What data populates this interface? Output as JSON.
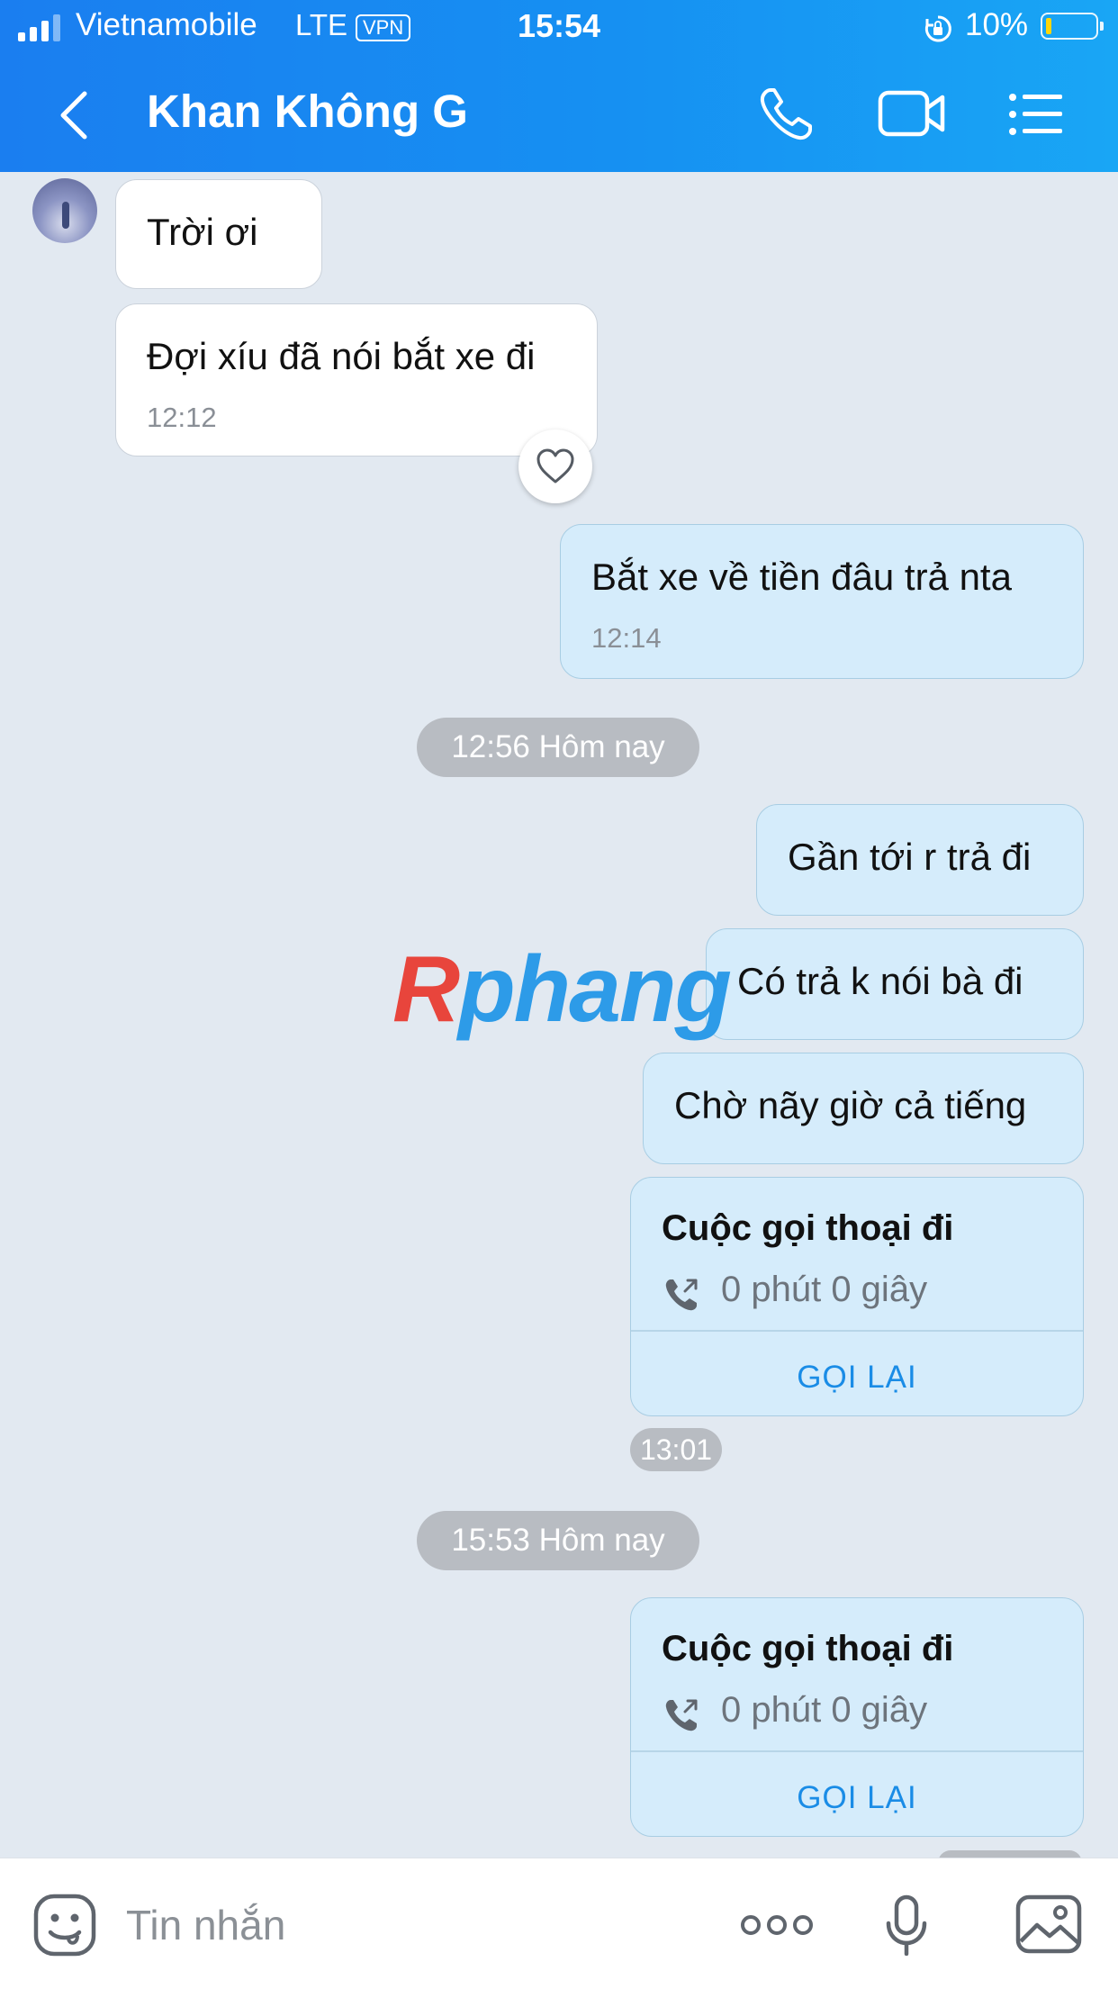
{
  "status_bar": {
    "carrier": "Vietnamobile",
    "network": "LTE",
    "vpn": "VPN",
    "time": "15:54",
    "battery": "10%"
  },
  "header": {
    "title": "Khan Không G",
    "icons": [
      "back-icon",
      "phone-icon",
      "video-call-icon",
      "menu-icon"
    ]
  },
  "messages": {
    "in1": {
      "text": "Trời ơi"
    },
    "in2": {
      "text": "Đợi xíu đã nói bắt xe đi",
      "time": "12:12"
    },
    "out1": {
      "text": "Bắt xe về tiền đâu trả nta",
      "time": "12:14"
    },
    "sep1": "12:56 Hôm nay",
    "out2": {
      "text": "Gần tới r trả đi"
    },
    "out3": {
      "text": "Có trả k nói bà đi"
    },
    "out4": {
      "text": "Chờ nãy giờ cả tiếng"
    },
    "call1": {
      "title": "Cuộc gọi thoại đi",
      "duration": "0 phút 0 giây",
      "recall": "GỌI LẠI",
      "time": "13:01"
    },
    "sep2": "15:53 Hôm nay",
    "call2": {
      "title": "Cuộc gọi thoại đi",
      "duration": "0 phút 0 giây",
      "recall": "GỌI LẠI"
    }
  },
  "watermark": {
    "first": "R",
    "rest": "phang"
  },
  "input": {
    "placeholder": "Tin nhắn"
  },
  "colors": {
    "header_start": "#1a7ef0",
    "header_end": "#19a6f5",
    "outgoing_bubble": "#d5ecfb",
    "incoming_bubble": "#ffffff",
    "recall_link": "#1a8ce6"
  }
}
